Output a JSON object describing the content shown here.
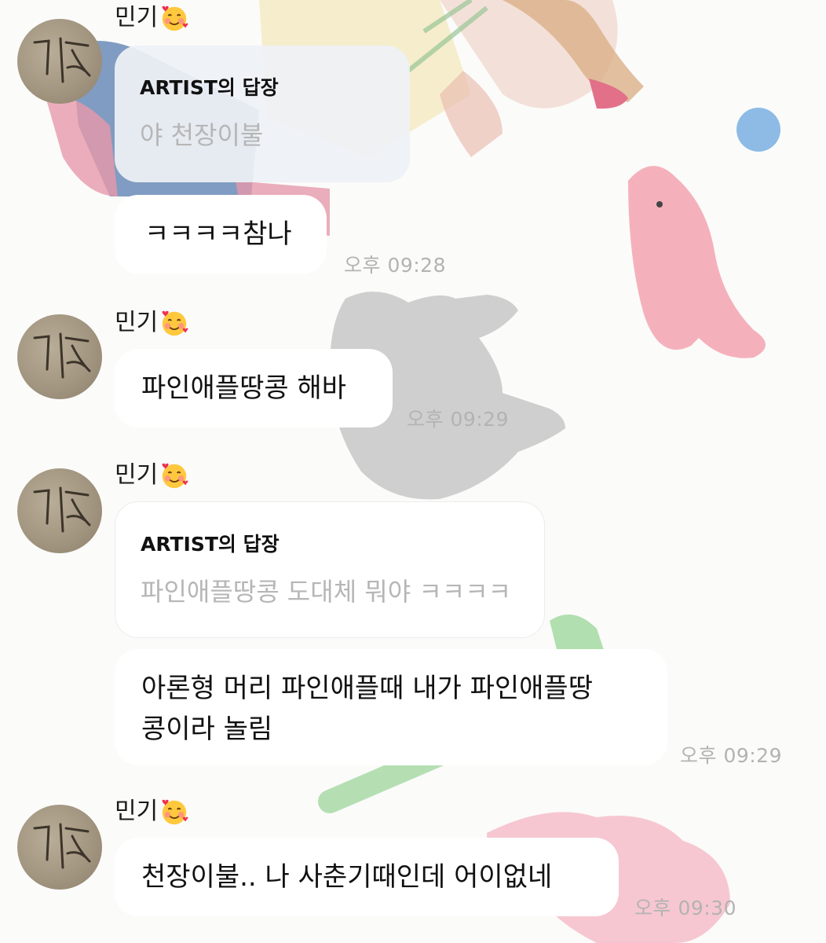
{
  "colors": {
    "bubble": "#ffffff",
    "reply_bg": "#eef1f5",
    "timestamp": "#b3b3b3",
    "quote_text": "#b6b6b6"
  },
  "icons": {
    "sender_emoji": "smiling-face-with-hearts-icon",
    "avatar": "handwritten-avatar-icon"
  },
  "messages": [
    {
      "sender": "민기",
      "reply": {
        "title": "ARTIST의 답장",
        "quote": "야 천장이불"
      },
      "text": "ㅋㅋㅋㅋ참나",
      "time": "오후 09:28"
    },
    {
      "sender": "민기",
      "text": "파인애플땅콩 해바",
      "time": "오후 09:29"
    },
    {
      "sender": "민기",
      "reply": {
        "title": "ARTIST의 답장",
        "quote": "파인애플땅콩 도대체 뭐야 ㅋㅋㅋㅋ"
      },
      "text": "아론형 머리 파인애플때 내가 파인애플땅\n콩이라 놀림",
      "time": "오후 09:29"
    },
    {
      "sender": "민기",
      "text": "천장이불.. 나 사춘기때인데 어이없네",
      "time": "오후 09:30"
    }
  ]
}
